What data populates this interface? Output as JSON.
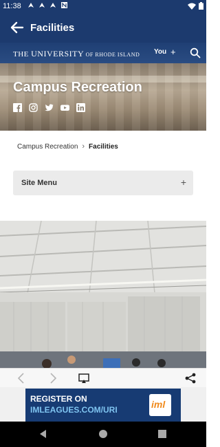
{
  "status_bar": {
    "time": "11:38",
    "notification_icons": [
      "nav-icon",
      "nav-icon",
      "nav-icon",
      "n-icon"
    ],
    "system_icons": [
      "wifi-icon",
      "battery-icon"
    ]
  },
  "app_bar": {
    "back_icon": "arrow-back-icon",
    "title": "Facilities"
  },
  "university_header": {
    "logo_the": "THE ",
    "logo_university": "UNIVERSITY",
    "logo_of": " OF RHODE ISLAND",
    "you_label": "You",
    "plus_label": "+",
    "search_icon": "search-icon"
  },
  "hero": {
    "title": "Campus Recreation",
    "social_icons": [
      "facebook-icon",
      "instagram-icon",
      "twitter-icon",
      "youtube-icon",
      "linkedin-icon"
    ]
  },
  "breadcrumb": {
    "parent": "Campus Recreation",
    "separator": "›",
    "current": "Facilities"
  },
  "site_menu": {
    "label": "Site Menu",
    "expand": "+"
  },
  "browser_toolbar": {
    "icons": [
      "chevron-left-icon",
      "chevron-right-icon",
      "cast-icon",
      "share-icon"
    ]
  },
  "ad": {
    "line1": "REGISTER ON",
    "line2": "IMLEAGUES.COM/URI",
    "logo_text": "iml"
  },
  "colors": {
    "brand_navy": "#1c3a6e",
    "ad_blue": "#173b73",
    "ad_accent": "#7fc4f0",
    "logo_orange": "#f08a1c"
  }
}
